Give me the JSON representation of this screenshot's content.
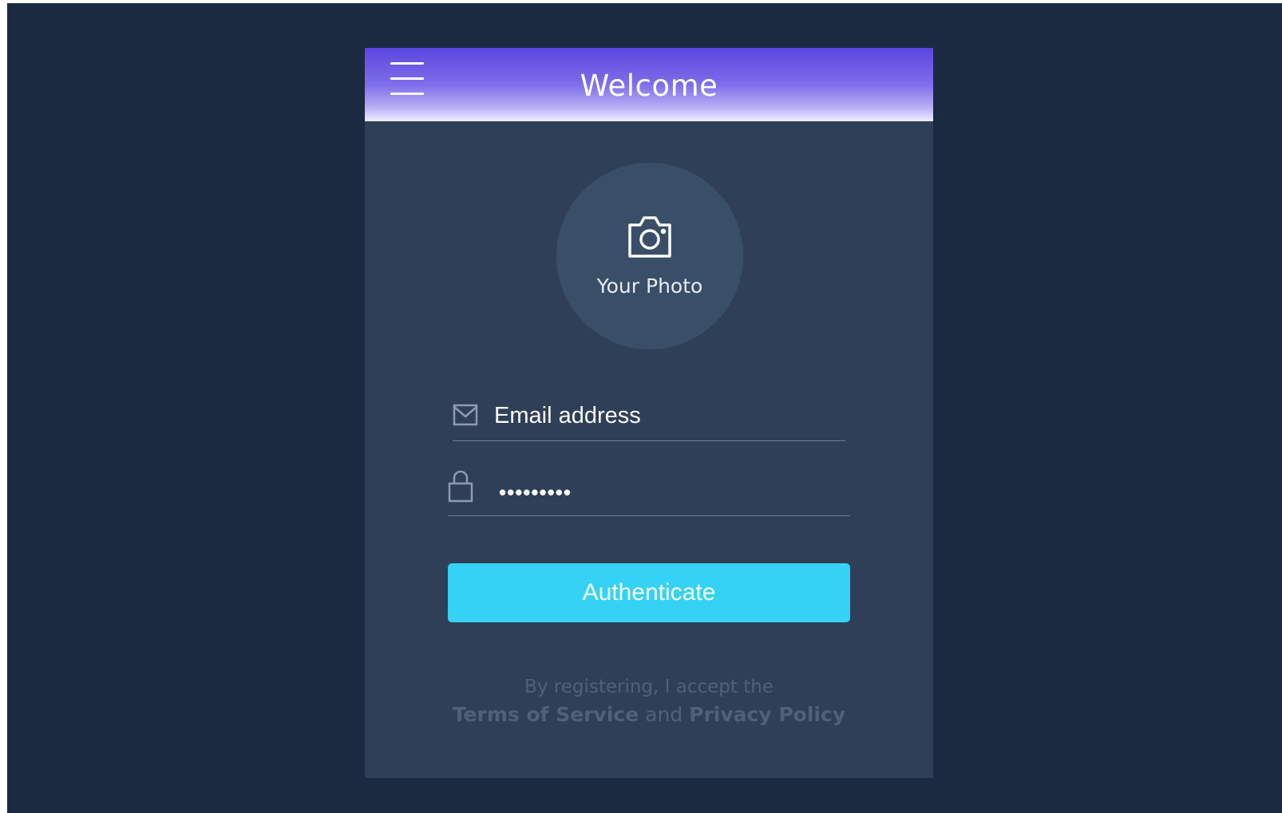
{
  "header": {
    "title": "Welcome",
    "menu_icon": "hamburger-menu-icon"
  },
  "photo": {
    "label": "Your Photo",
    "icon": "camera-icon"
  },
  "email": {
    "placeholder": "Email address",
    "icon": "envelope-icon"
  },
  "password": {
    "value": "•••••••••",
    "icon": "lock-icon"
  },
  "auth_button": {
    "label": "Authenticate"
  },
  "legal": {
    "line1": "By registering, I accept the",
    "terms_link": "Terms of Service",
    "and": "and",
    "privacy_link": "Privacy Policy"
  },
  "colors": {
    "background": "#1b2a41",
    "card": "#2f3f57",
    "header_gradient_start": "#5a46dd",
    "header_gradient_end": "#efeefe",
    "accent_button": "#35d2f5",
    "photo_circle": "#3b4e68",
    "muted_text": "#4f6079"
  }
}
